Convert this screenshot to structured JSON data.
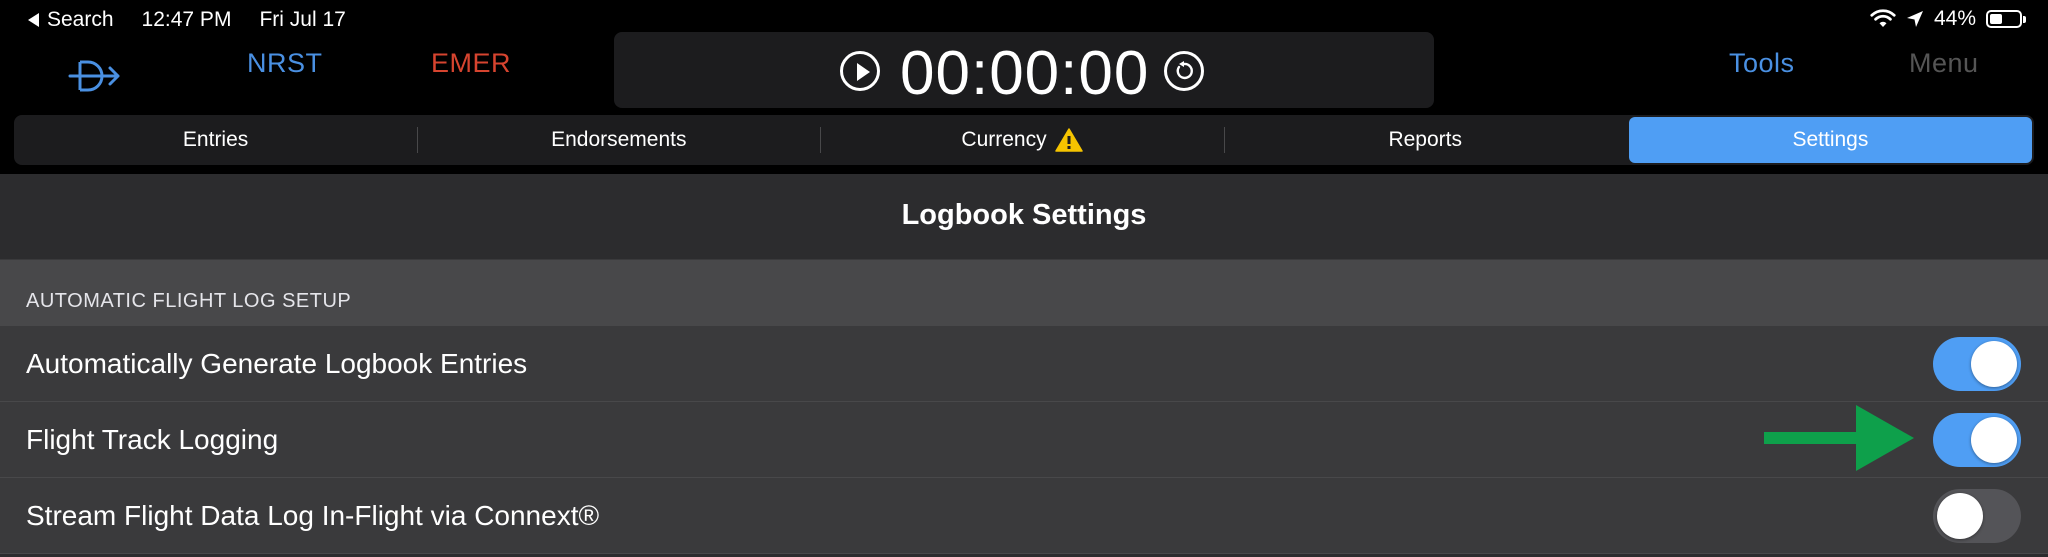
{
  "status_bar": {
    "back_label": "Search",
    "time": "12:47 PM",
    "date": "Fri Jul 17",
    "battery": "44%",
    "battery_level": 0.44
  },
  "toolbar": {
    "nrst": "NRST",
    "emer": "EMER",
    "timer": "00:00:00",
    "tools": "Tools",
    "menu": "Menu"
  },
  "tabs": [
    {
      "label": "Entries"
    },
    {
      "label": "Endorsements"
    },
    {
      "label": "Currency"
    },
    {
      "label": "Reports"
    },
    {
      "label": "Settings",
      "active": true
    }
  ],
  "page": {
    "title": "Logbook Settings",
    "section_header": "AUTOMATIC FLIGHT LOG SETUP"
  },
  "rows": [
    {
      "label": "Automatically Generate Logbook Entries",
      "toggle": true
    },
    {
      "label": "Flight Track Logging",
      "toggle": true
    },
    {
      "label": "Stream Flight Data Log In-Flight via Connext®",
      "toggle": false
    }
  ],
  "colors": {
    "accent": "#4f9ef4",
    "link_blue": "#4a90e2",
    "emergency_red": "#d6442f",
    "warning_yellow": "#f5c400",
    "annotation_arrow": "#0ea04b"
  },
  "icons": [
    "back-triangle-icon",
    "direct-to-icon",
    "play-icon",
    "reset-icon",
    "warning-icon",
    "wifi-icon",
    "location-arrow-icon",
    "battery-icon",
    "green-arrow-annotation"
  ]
}
